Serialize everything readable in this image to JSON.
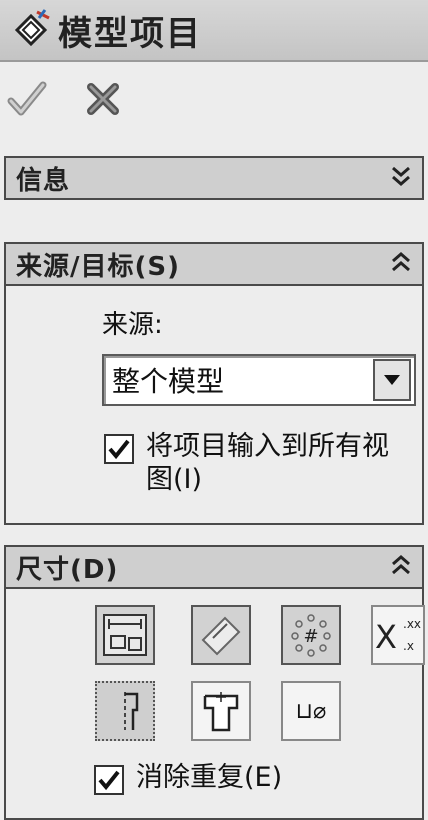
{
  "window": {
    "title": "模型项目",
    "icon": "model-items-icon"
  },
  "actions": [
    {
      "name": "ok",
      "icon": "checkmark-icon"
    },
    {
      "name": "cancel",
      "icon": "close-x-icon"
    }
  ],
  "panels": {
    "info": {
      "title": "信息",
      "state": "collapsed",
      "chevron": "double-chevron-down-icon"
    },
    "source": {
      "title": "来源/目标(S)",
      "state": "expanded",
      "chevron": "double-chevron-up-icon",
      "source_label": "来源:",
      "source_select": {
        "value": "整个模型"
      },
      "import_checkbox": {
        "label": "将项目输入到所有视图(I)",
        "checked": true
      }
    },
    "dimensions": {
      "title": "尺寸(D)",
      "state": "expanded",
      "chevron": "double-chevron-up-icon",
      "tools": [
        {
          "name": "marked-for-drawing",
          "icon": "drawing-dimension-icon",
          "selected": true
        },
        {
          "name": "not-marked-for-drawing",
          "icon": "angled-dimension-icon",
          "selected": true
        },
        {
          "name": "instance-count",
          "icon": "pattern-count-icon",
          "selected": true
        },
        {
          "name": "tolerance-dimensions",
          "icon": "tolerance-x-icon",
          "selected": false,
          "text": "X",
          "sup": ".xx",
          "sub": ".x"
        },
        {
          "name": "hole-wizard-profile",
          "icon": "hole-profile-icon",
          "selected": true
        },
        {
          "name": "hole-wizard-locations",
          "icon": "hole-location-icon",
          "selected": false
        },
        {
          "name": "hole-callout",
          "icon": "hole-callout-icon",
          "selected": false,
          "text": "⊔⌀"
        }
      ],
      "dedupe_checkbox": {
        "label": "消除重复(E)",
        "checked": true
      }
    }
  },
  "colors": {
    "header": "#cfcfcf",
    "panel_bg": "#ededed",
    "border": "#4a4a4a",
    "accent_check": "#3c8a3c"
  }
}
